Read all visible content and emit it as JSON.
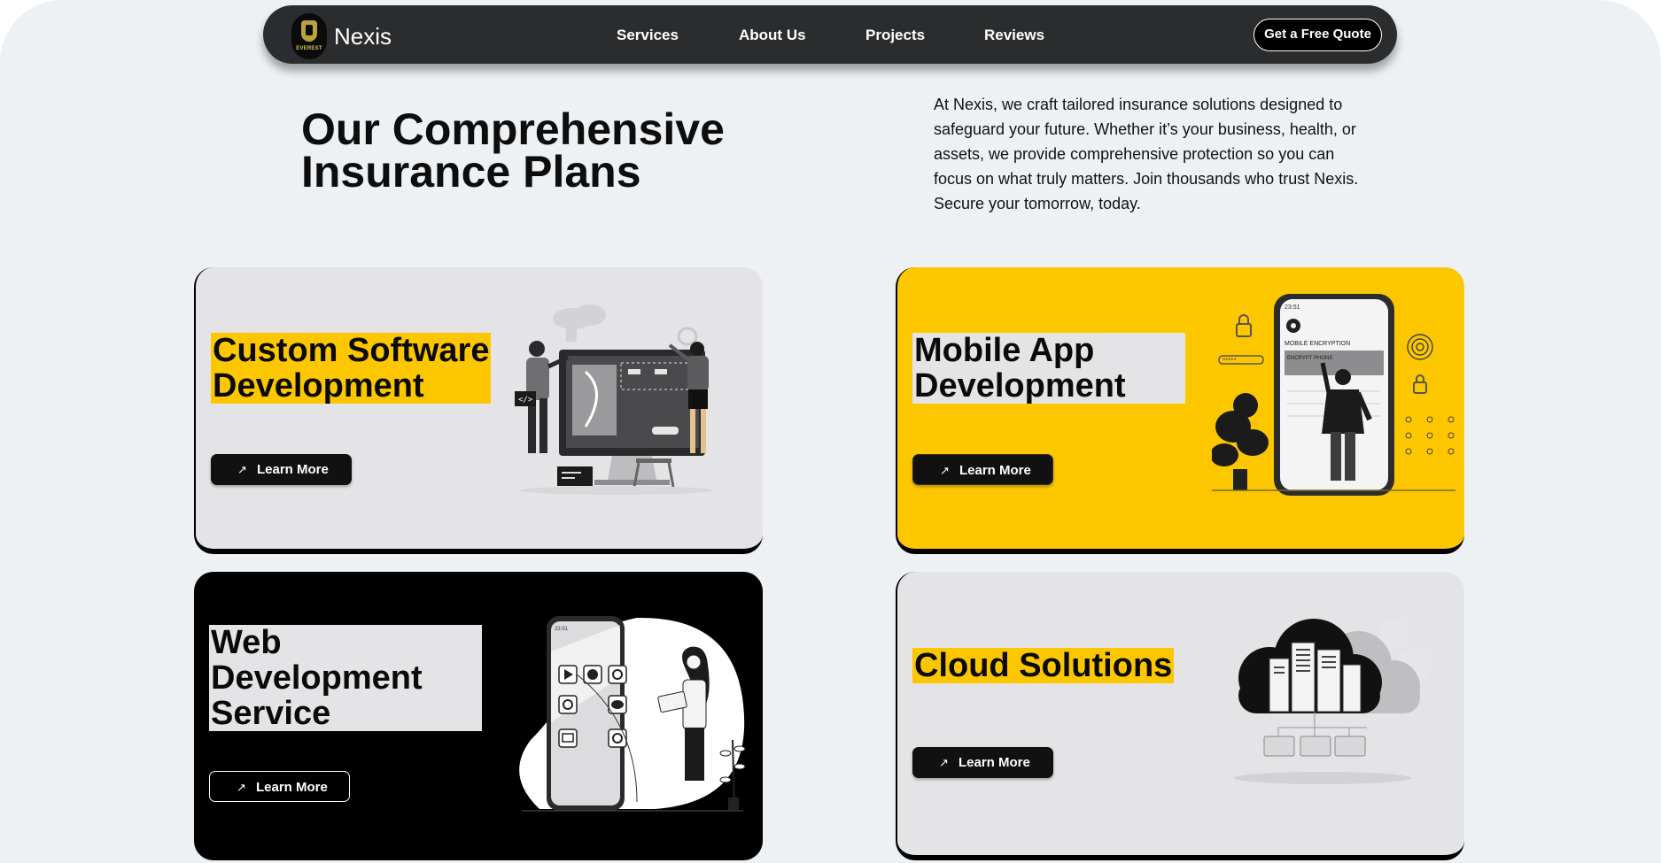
{
  "nav": {
    "logo_text": "EVEREST",
    "brand": "Nexis",
    "links": [
      "Services",
      "About Us",
      "Projects",
      "Reviews"
    ],
    "cta": "Get a Free Quote"
  },
  "hero": {
    "title_line1": "Our Comprehensive",
    "title_line2": "Insurance Plans",
    "description": "At Nexis, we craft tailored insurance solutions designed to safeguard your future. Whether it’s your business, health, or assets, we provide comprehensive protection so you can focus on what truly matters. Join thousands who trust Nexis. Secure your tomorrow, today."
  },
  "cards": [
    {
      "title_line1": "Custom Software",
      "title_line2": "Development",
      "button": "Learn More"
    },
    {
      "title_line1": "Mobile App",
      "title_line2": "Development",
      "button": "Learn More",
      "illustration_text": {
        "time": "23:51",
        "heading": "MOBILE ENCRYPTION",
        "field": "ENCRYPT PHONE"
      }
    },
    {
      "title_line1": "Web",
      "title_line2": "Development",
      "title_line3": "Service",
      "button": "Learn More",
      "illustration_text": {
        "time": "23:51"
      }
    },
    {
      "title_line1": "Cloud Solutions",
      "button": "Learn More"
    }
  ],
  "colors": {
    "accent_yellow": "#fdc700",
    "nav_bg": "#2b2c2e",
    "page_bg": "#eef1f3",
    "card_grey": "#e4e4e6",
    "black": "#000000"
  },
  "icons": [
    "arrow-up-right-icon",
    "logo-shield-icon"
  ]
}
